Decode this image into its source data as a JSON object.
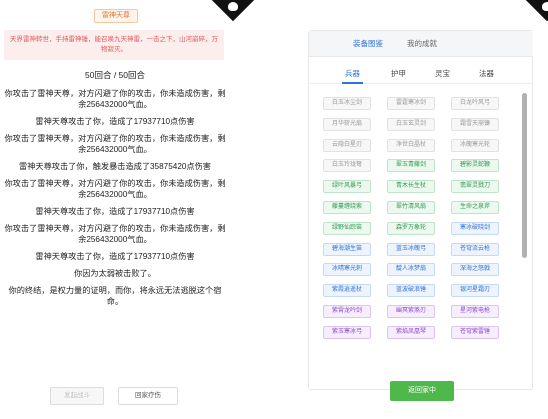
{
  "battle": {
    "boss_name": "雷神天尊",
    "boss_desc": "天界雷神转世，手持雷神锤，能召唤九天神雷，一击之下，山河崩碎，万物寂灭。",
    "round_text": "50回合 / 50回合",
    "log": [
      "你攻击了雷神天尊，对方闪避了你的攻击，你未造成伤害，剩余256432000气血。",
      "雷神天尊攻击了你，造成了17937710点伤害",
      "你攻击了雷神天尊，对方闪避了你的攻击，你未造成伤害，剩余256432000气血。",
      "雷神天尊攻击了你，触发暴击造成了35875420点伤害",
      "你攻击了雷神天尊，对方闪避了你的攻击，你未造成伤害，剩余256432000气血。",
      "雷神天尊攻击了你，造成了17937710点伤害",
      "你攻击了雷神天尊，对方闪避了你的攻击，你未造成伤害，剩余256432000气血。",
      "雷神天尊攻击了你，造成了17937710点伤害",
      "你因为太弱被击败了。",
      "你的终结，是权力量的证明，而你，将永远无法逃脱这个宿命。"
    ],
    "start_button": "发起战斗",
    "return_home_button": "回家疗伤"
  },
  "gallery": {
    "tabs": [
      "装备图鉴",
      "我的成就"
    ],
    "subtabs": [
      "兵器",
      "护甲",
      "灵宝",
      "法器"
    ],
    "items": [
      {
        "label": "白玉冰尘剑",
        "tier": "gray"
      },
      {
        "label": "雷霆寒冰剑",
        "tier": "gray"
      },
      {
        "label": "白龙吟风弓",
        "tier": "gray"
      },
      {
        "label": "月华斩光扇",
        "tier": "gray"
      },
      {
        "label": "白玉玄灵剑",
        "tier": "gray"
      },
      {
        "label": "霜雪天崩镰",
        "tier": "gray"
      },
      {
        "label": "云隐白星刃",
        "tier": "gray"
      },
      {
        "label": "净世白晶杖",
        "tier": "gray"
      },
      {
        "label": "冰魄寒光轮",
        "tier": "gray"
      },
      {
        "label": "白玉玲珑弩",
        "tier": "gray"
      },
      {
        "label": "翠玉青藤剑",
        "tier": "green"
      },
      {
        "label": "碧影灵蛇鞭",
        "tier": "green"
      },
      {
        "label": "绿叶风暴弓",
        "tier": "green"
      },
      {
        "label": "青木长生杖",
        "tier": "green"
      },
      {
        "label": "翡翠灵戮刀",
        "tier": "green"
      },
      {
        "label": "藤蔓缠绕索",
        "tier": "green"
      },
      {
        "label": "翠竹清风扇",
        "tier": "green"
      },
      {
        "label": "生命之泉斧",
        "tier": "green"
      },
      {
        "label": "绿野仙踪笛",
        "tier": "green"
      },
      {
        "label": "森罗万象轮",
        "tier": "green"
      },
      {
        "label": "寒冰破晓剑",
        "tier": "blue"
      },
      {
        "label": "碧海潮生笛",
        "tier": "blue"
      },
      {
        "label": "蓝玉冰魄弓",
        "tier": "blue"
      },
      {
        "label": "苍穹流云枪",
        "tier": "blue"
      },
      {
        "label": "冰晴寒光刺",
        "tier": "blue"
      },
      {
        "label": "靛人冰梦扇",
        "tier": "blue"
      },
      {
        "label": "深海之怒戟",
        "tier": "blue"
      },
      {
        "label": "紫霞逍遥杖",
        "tier": "blue"
      },
      {
        "label": "蓝波破浪锤",
        "tier": "blue"
      },
      {
        "label": "银河星霜刃",
        "tier": "blue"
      },
      {
        "label": "紫霄龙吟剑",
        "tier": "purple"
      },
      {
        "label": "幽冥紫煞刃",
        "tier": "purple"
      },
      {
        "label": "星河紫电枪",
        "tier": "purple"
      },
      {
        "label": "紫玉寒冰弓",
        "tier": "purple"
      },
      {
        "label": "紫焰凤凰琴",
        "tier": "purple"
      },
      {
        "label": "苍穹紫雷锤",
        "tier": "purple"
      }
    ],
    "return_button": "返回家中"
  },
  "colors": {
    "accent_blue": "#2f73d8",
    "green_button": "#4fb84a",
    "boss_red": "#e0595b"
  }
}
